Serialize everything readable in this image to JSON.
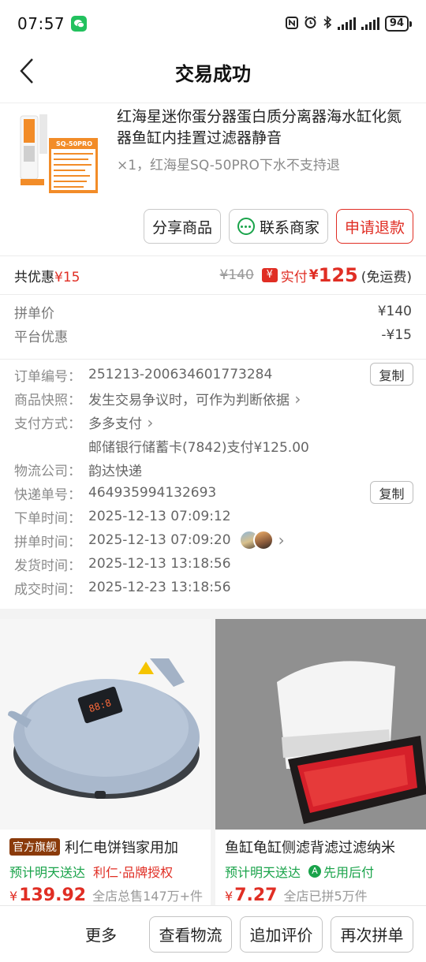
{
  "status": {
    "time": "07:57",
    "battery": "94"
  },
  "header": {
    "title": "交易成功"
  },
  "product": {
    "thumb_label": "SQ-50PRO",
    "title": "红海星迷你蛋分器蛋白质分离器海水缸化氮器鱼缸内挂置过滤器静音",
    "spec": "×1，红海星SQ-50PRO下水不支持退",
    "actions": {
      "share": "分享商品",
      "contact": "联系商家",
      "refund": "申请退款"
    }
  },
  "summary": {
    "discount_label": "共优惠",
    "discount_value": "¥15",
    "original_price": "¥140",
    "paid_icon": "¥",
    "paid_label": "实付",
    "paid_currency": "¥",
    "paid_amount": "125",
    "shipping_note": "(免运费)"
  },
  "prices": [
    {
      "label": "拼单价",
      "value": "¥140"
    },
    {
      "label": "平台优惠",
      "value": "-¥15"
    }
  ],
  "order_info": {
    "copy_label": "复制",
    "order_no": {
      "label": "订单编号：",
      "value": "251213-200634601773284"
    },
    "snapshot": {
      "label": "商品快照：",
      "value": "发生交易争议时，可作为判断依据"
    },
    "payment": {
      "label": "支付方式：",
      "value": "多多支付",
      "detail": "邮储银行储蓄卡(7842)支付¥125.00"
    },
    "carrier": {
      "label": "物流公司：",
      "value": "韵达快递"
    },
    "tracking": {
      "label": "快递单号：",
      "value": "464935994132693"
    },
    "order_time": {
      "label": "下单时间：",
      "value": "2025-12-13 07:09:12"
    },
    "group_time": {
      "label": "拼单时间：",
      "value": "2025-12-13 07:09:20"
    },
    "ship_time": {
      "label": "发货时间：",
      "value": "2025-12-13 13:18:56"
    },
    "deal_time": {
      "label": "成交时间：",
      "value": "2025-12-23 13:18:56"
    }
  },
  "recommendations": [
    {
      "tag": "官方旗舰",
      "title": "利仁电饼铛家用加",
      "delivery": "预计明天送达",
      "brand": "利仁·品牌授权",
      "currency": "¥",
      "price": "139.92",
      "sales": "全店总售147万+件"
    },
    {
      "title": "鱼缸龟缸侧滤背滤过滤纳米",
      "delivery": "预计明天送达",
      "credit_icon": "A",
      "credit": "先用后付",
      "currency": "¥",
      "price": "7.27",
      "sales": "全店已拼5万件"
    }
  ],
  "bottom_bar": {
    "more": "更多",
    "logistics": "查看物流",
    "review": "追加评价",
    "reorder": "再次拼单"
  },
  "colors": {
    "accent_red": "#e02e24",
    "green": "#19a34a"
  }
}
